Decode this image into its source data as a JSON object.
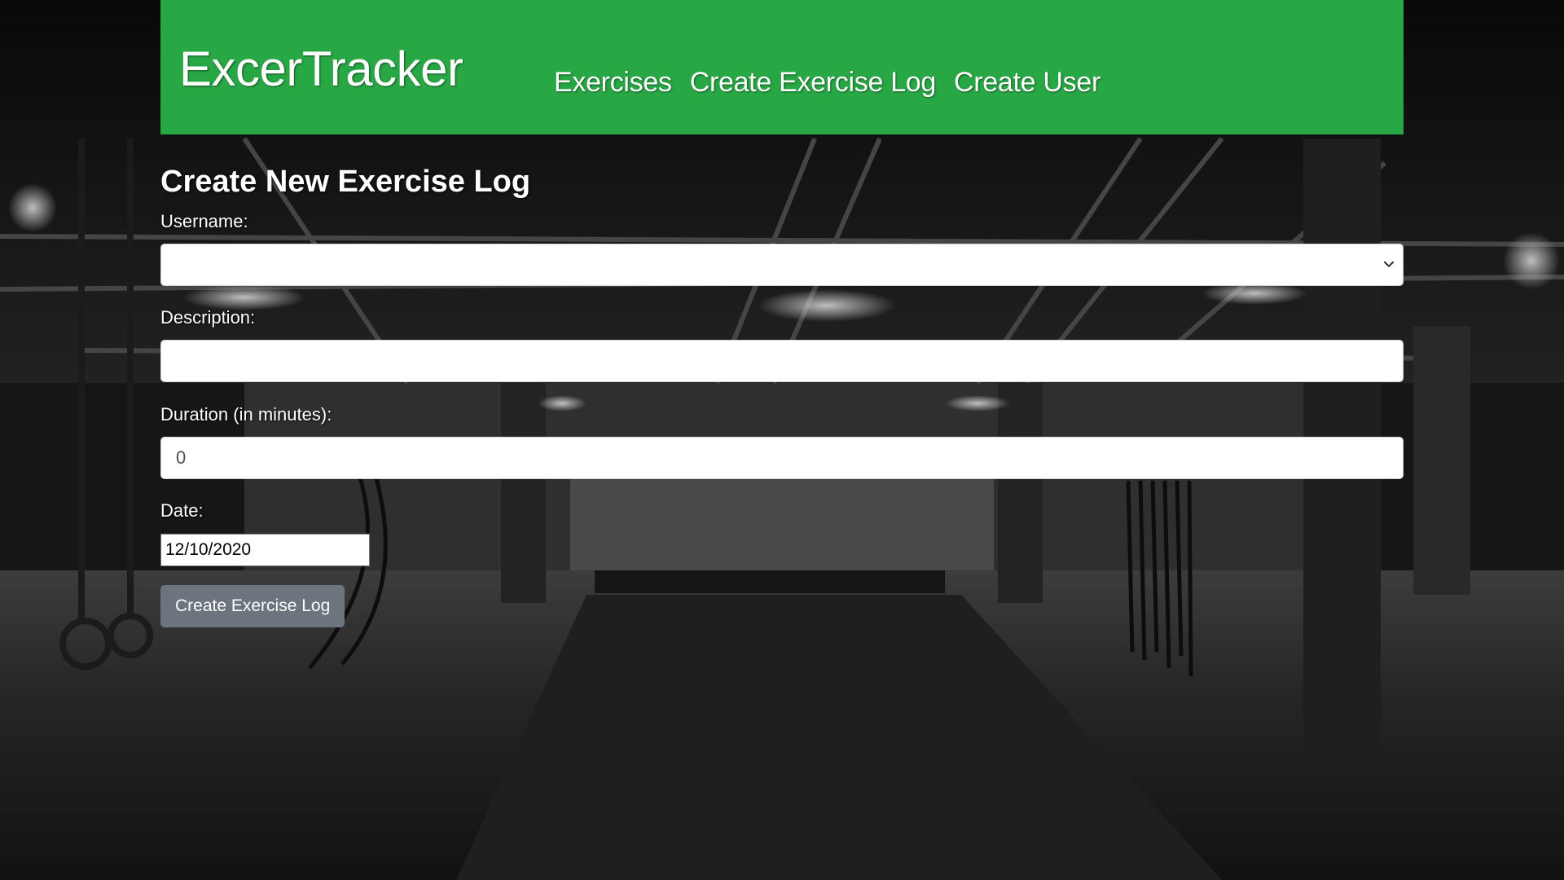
{
  "app": {
    "brand": "ExcerTracker"
  },
  "nav": {
    "items": [
      {
        "label": "Exercises"
      },
      {
        "label": "Create Exercise Log"
      },
      {
        "label": "Create User"
      }
    ]
  },
  "form": {
    "title": "Create New Exercise Log",
    "username": {
      "label": "Username:",
      "value": ""
    },
    "description": {
      "label": "Description:",
      "value": ""
    },
    "duration": {
      "label": "Duration (in minutes):",
      "value": "0"
    },
    "date": {
      "label": "Date:",
      "value": "12/10/2020"
    },
    "submit_label": "Create Exercise Log"
  },
  "colors": {
    "navbar": "#28a745",
    "button": "#6c757d"
  }
}
